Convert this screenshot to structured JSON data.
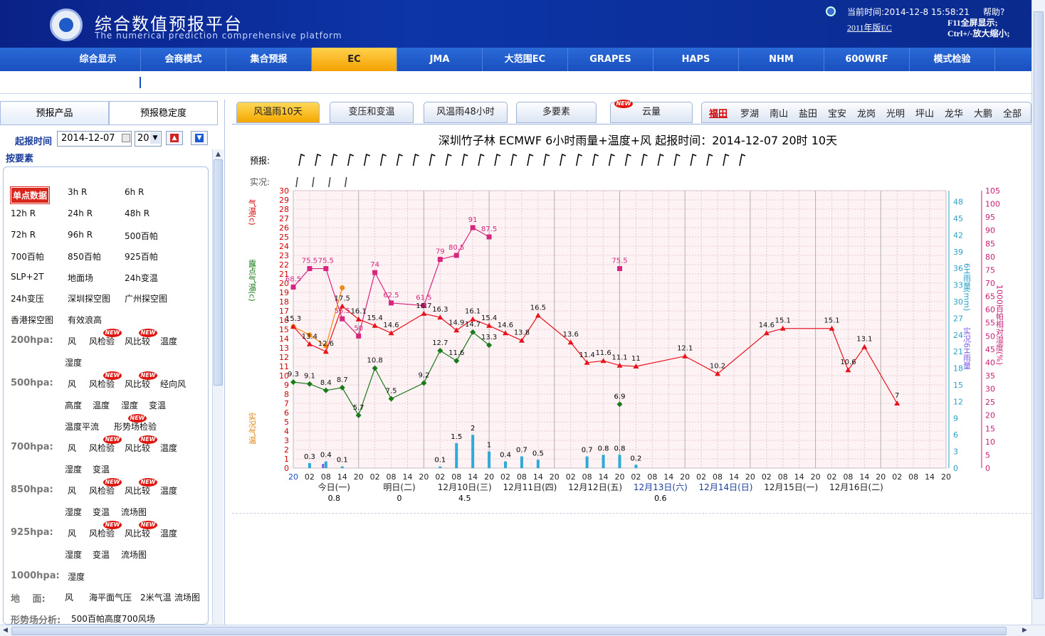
{
  "header": {
    "title_cn": "综合数值预报平台",
    "title_en": "The numerical prediction comprehensive platform",
    "time_label": "当前时间:2014-12-8 15:58:21",
    "help": "帮助?",
    "version_link": "2011年版EC",
    "fullscreen_tip": "F11全屏显示;",
    "zoom_tip": "Ctrl+/-放大缩小;"
  },
  "nav": [
    "综合显示",
    "会商模式",
    "集合预报",
    "EC",
    "JMA",
    "大范围EC",
    "GRAPES",
    "HAPS",
    "NHM",
    "600WRF",
    "模式检验"
  ],
  "nav_active": 3,
  "sidebar": {
    "tabs": [
      "预报产品",
      "预报稳定度"
    ],
    "date_label": "起报时间",
    "date_value": "2014-12-07",
    "hour_value": "20",
    "section_title": "按要素",
    "rows": [
      {
        "y": 28,
        "cells": [
          [
            "单点数据",
            10,
            "sel"
          ],
          [
            "3h R",
            90
          ],
          [
            "6h R",
            170
          ]
        ]
      },
      {
        "y": 58,
        "cells": [
          [
            "12h R",
            10
          ],
          [
            "24h R",
            90
          ],
          [
            "48h R",
            170
          ]
        ]
      },
      {
        "y": 88,
        "cells": [
          [
            "72h R",
            10
          ],
          [
            "96h R",
            90
          ],
          [
            "500百帕",
            170
          ]
        ]
      },
      {
        "y": 117,
        "cells": [
          [
            "700百帕",
            10
          ],
          [
            "850百帕",
            90
          ],
          [
            "925百帕",
            170
          ]
        ]
      },
      {
        "y": 147,
        "cells": [
          [
            "SLP+2T",
            10
          ],
          [
            "地面场",
            90
          ],
          [
            "24h变温",
            170
          ]
        ]
      },
      {
        "y": 176,
        "cells": [
          [
            "24h变压",
            10
          ],
          [
            "深圳探空图",
            90
          ],
          [
            "广州探空图",
            170
          ]
        ]
      },
      {
        "y": 206,
        "cells": [
          [
            "香港探空图",
            10
          ],
          [
            "有效浪高",
            90
          ]
        ]
      },
      {
        "y": 236,
        "cells": [
          [
            "200hpa:",
            10,
            "hpa"
          ],
          [
            "风",
            90
          ],
          [
            "风检验",
            120
          ],
          [
            "风比较",
            170
          ],
          [
            "温度",
            220
          ]
        ]
      },
      {
        "y": 266,
        "cells": [
          [
            "湿度",
            86
          ]
        ]
      },
      {
        "y": 296,
        "cells": [
          [
            "500hpa:",
            10,
            "hpa"
          ],
          [
            "风",
            90
          ],
          [
            "风检验",
            120
          ],
          [
            "风比较",
            170
          ],
          [
            "经向风",
            220
          ]
        ]
      },
      {
        "y": 326,
        "cells": [
          [
            "高度",
            86
          ],
          [
            "温度",
            125
          ],
          [
            "湿度",
            165
          ],
          [
            "变温",
            204
          ]
        ]
      },
      {
        "y": 356,
        "cells": [
          [
            "温度平流",
            86
          ],
          [
            "形势场检验",
            155
          ]
        ]
      },
      {
        "y": 386,
        "cells": [
          [
            "700hpa:",
            10,
            "hpa"
          ],
          [
            "风",
            90
          ],
          [
            "风检验",
            120
          ],
          [
            "风比较",
            170
          ],
          [
            "温度",
            220
          ]
        ]
      },
      {
        "y": 416,
        "cells": [
          [
            "湿度",
            86
          ],
          [
            "变温",
            125
          ]
        ]
      },
      {
        "y": 446,
        "cells": [
          [
            "850hpa:",
            10,
            "hpa"
          ],
          [
            "风",
            90
          ],
          [
            "风检验",
            120
          ],
          [
            "风比较",
            170
          ],
          [
            "温度",
            220
          ]
        ]
      },
      {
        "y": 476,
        "cells": [
          [
            "湿度",
            86
          ],
          [
            "变温",
            125
          ],
          [
            "流场图",
            165
          ]
        ]
      },
      {
        "y": 506,
        "cells": [
          [
            "925hpa:",
            10,
            "hpa"
          ],
          [
            "风",
            90
          ],
          [
            "风检验",
            120
          ],
          [
            "风比较",
            170
          ],
          [
            "温度",
            220
          ]
        ]
      },
      {
        "y": 536,
        "cells": [
          [
            "湿度",
            86
          ],
          [
            "变温",
            125
          ],
          [
            "流场图",
            165
          ]
        ]
      },
      {
        "y": 567,
        "cells": [
          [
            "1000hpa:",
            10,
            "hpa"
          ],
          [
            "湿度",
            90
          ]
        ]
      },
      {
        "y": 596,
        "cells": [
          [
            "地　 面:",
            10,
            "hpa"
          ],
          [
            "风",
            86
          ],
          [
            "海平面气压",
            120
          ],
          [
            "2米气温",
            192
          ],
          [
            "流场图",
            240
          ]
        ]
      },
      {
        "y": 626,
        "cells": [
          [
            "形势场分析:",
            10,
            "hpa"
          ],
          [
            "500百帕高度700风场",
            95
          ]
        ]
      }
    ],
    "new_badges": [
      [
        140,
        227
      ],
      [
        190,
        227
      ],
      [
        140,
        287
      ],
      [
        190,
        287
      ],
      [
        175,
        347
      ],
      [
        140,
        377
      ],
      [
        190,
        377
      ],
      [
        140,
        437
      ],
      [
        190,
        437
      ],
      [
        140,
        497
      ],
      [
        190,
        497
      ]
    ],
    "new_label": "NEW"
  },
  "product_tabs": [
    "风温雨10天",
    "变压和变温",
    "风温雨48小时",
    "多要素",
    "云量"
  ],
  "product_active": 0,
  "stations": [
    "福田",
    "罗湖",
    "南山",
    "盐田",
    "宝安",
    "龙岗",
    "光明",
    "坪山",
    "龙华",
    "大鹏",
    "全部"
  ],
  "station_active": 0,
  "chart_data": {
    "type": "line",
    "title": "深圳竹子林  ECMWF  6小时雨量+温度+风  起报时间：2014-12-07 20时  10天",
    "forecast_label": "预报:",
    "obs_label": "实况:",
    "ylabel_temp": "气温(c)",
    "ylabel_dew": "露点气温(c)",
    "ylabel_obs": "实况气温",
    "ylabel_rain": "6H雨量(mm)",
    "ylabel_rain_obs": "实况6H雨量",
    "ylabel_rh": "1000百帕相对湿度(%)",
    "ylim_temp": [
      0,
      30
    ],
    "ylim_rain": [
      0,
      50
    ],
    "ylim_rh": [
      0,
      105
    ],
    "x_ticks": [
      "20",
      "02",
      "08",
      "14",
      "20",
      "02",
      "08",
      "14",
      "20",
      "02",
      "08",
      "14",
      "20",
      "02",
      "08",
      "14",
      "20",
      "02",
      "08",
      "14",
      "20",
      "02",
      "08",
      "14",
      "20",
      "02",
      "08",
      "14",
      "20",
      "02",
      "08",
      "14",
      "20",
      "02",
      "08",
      "14",
      "20",
      "02",
      "08",
      "14",
      "20"
    ],
    "days": [
      "今日(一)",
      "明日(二)",
      "12月10日(三)",
      "12月11日(四)",
      "12月12日(五)",
      "12月13日(六)",
      "12月14日(日)",
      "12月15日(一)",
      "12月16日(二)"
    ],
    "day_totals": [
      "0.8",
      "0",
      "4.5",
      "",
      "",
      "0.6",
      "",
      "",
      ""
    ],
    "temperature": [
      {
        "x": 0,
        "y": 15.3
      },
      {
        "x": 1,
        "y": 13.4
      },
      {
        "x": 2,
        "y": 12.6
      },
      {
        "x": 3,
        "y": 17.5
      },
      {
        "x": 4,
        "y": 16.1
      },
      {
        "x": 5,
        "y": 15.4
      },
      {
        "x": 6,
        "y": 14.6
      },
      {
        "x": 8,
        "y": 16.7
      },
      {
        "x": 9,
        "y": 16.3
      },
      {
        "x": 10,
        "y": 14.9
      },
      {
        "x": 11,
        "y": 16.1
      },
      {
        "x": 12,
        "y": 15.4
      },
      {
        "x": 13,
        "y": 14.6
      },
      {
        "x": 14,
        "y": 13.8
      },
      {
        "x": 15,
        "y": 16.5
      },
      {
        "x": 17,
        "y": 13.6
      },
      {
        "x": 18,
        "y": 11.4
      },
      {
        "x": 19,
        "y": 11.6
      },
      {
        "x": 20,
        "y": 11.1
      },
      {
        "x": 21,
        "y": 11
      },
      {
        "x": 24,
        "y": 12.1
      },
      {
        "x": 26,
        "y": 10.2
      },
      {
        "x": 29,
        "y": 14.6
      },
      {
        "x": 30,
        "y": 15.1
      },
      {
        "x": 33,
        "y": 15.1
      },
      {
        "x": 34,
        "y": 10.6
      },
      {
        "x": 35,
        "y": 13.1
      },
      {
        "x": 37,
        "y": 7
      }
    ],
    "dew_point": [
      {
        "x": 0,
        "y": 9.3
      },
      {
        "x": 1,
        "y": 9.1
      },
      {
        "x": 2,
        "y": 8.4
      },
      {
        "x": 3,
        "y": 8.7
      },
      {
        "x": 4,
        "y": 5.7
      },
      {
        "x": 5,
        "y": 10.8
      },
      {
        "x": 6,
        "y": 7.5
      },
      {
        "x": 8,
        "y": 9.2
      },
      {
        "x": 9,
        "y": 12.7
      },
      {
        "x": 10,
        "y": 11.6
      },
      {
        "x": 11,
        "y": 14.7
      },
      {
        "x": 12,
        "y": 13.3
      }
    ],
    "dew_isolated": [
      {
        "x": 20,
        "y": 6.9
      }
    ],
    "humidity": [
      {
        "x": 0,
        "y": 68.5
      },
      {
        "x": 1,
        "y": 75.5
      },
      {
        "x": 2,
        "y": 75.5
      },
      {
        "x": 3,
        "y": 56.5
      },
      {
        "x": 4,
        "y": 50
      },
      {
        "x": 5,
        "y": 74
      },
      {
        "x": 6,
        "y": 62.5
      },
      {
        "x": 8,
        "y": 61.5
      },
      {
        "x": 9,
        "y": 79
      },
      {
        "x": 10,
        "y": 80.5
      },
      {
        "x": 11,
        "y": 91
      },
      {
        "x": 12,
        "y": 87.5
      }
    ],
    "humidity_isolated": [
      {
        "x": 20,
        "y": 75.5
      }
    ],
    "obs_temperature": [
      {
        "x": 0,
        "y": 15.3
      },
      {
        "x": 1,
        "y": 14.4
      },
      {
        "x": 2,
        "y": 13.2
      },
      {
        "x": 3,
        "y": 19.5
      }
    ],
    "rain": [
      {
        "x": 1,
        "y": 0.3
      },
      {
        "x": 2,
        "y": 0.4
      },
      {
        "x": 3,
        "y": 0.1
      },
      {
        "x": 9,
        "y": 0.1
      },
      {
        "x": 10,
        "y": 1.5
      },
      {
        "x": 11,
        "y": 2
      },
      {
        "x": 12,
        "y": 1
      },
      {
        "x": 13,
        "y": 0.4
      },
      {
        "x": 14,
        "y": 0.7
      },
      {
        "x": 15,
        "y": 0.5
      },
      {
        "x": 18,
        "y": 0.7
      },
      {
        "x": 19,
        "y": 0.8
      },
      {
        "x": 20,
        "y": 0.8
      },
      {
        "x": 21,
        "y": 0.2
      }
    ],
    "colors": {
      "temperature": "#e8121b",
      "dew_point": "#1a7a1a",
      "humidity": "#d6267d",
      "obs_temperature": "#f28a12",
      "rain": "#2fa9d8",
      "obs_rain": "#7b5ee8"
    }
  }
}
